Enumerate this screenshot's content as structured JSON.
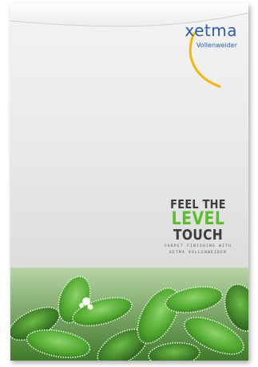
{
  "brand": {
    "name": "xetma",
    "subname": "Vollenweider",
    "accent_color": "#2f5aa6",
    "swoosh_color": "#f2b705"
  },
  "headline": {
    "line1": "FEEL THE",
    "line2": "LEVEL",
    "line3": "TOUCH",
    "tagline_line1": "CARPET FINISHING WITH",
    "tagline_line2": "XETMA VOLLENWEIDER",
    "dark_color": "#3d3d3d",
    "green_color": "#5cbf2a"
  },
  "image": {
    "subject": "frosted-green-leaves-photo"
  }
}
